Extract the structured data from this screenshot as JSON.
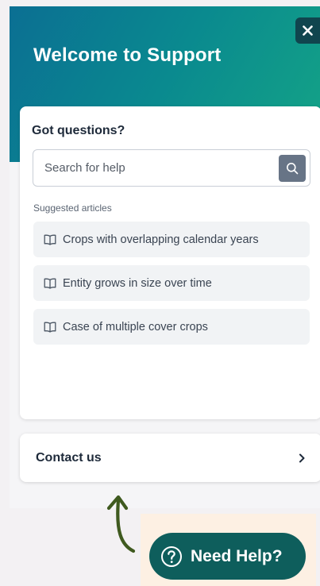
{
  "header": {
    "title": "Welcome to Support"
  },
  "card": {
    "title": "Got questions?",
    "search_placeholder": "Search for help",
    "suggested_label": "Suggested articles",
    "articles": [
      {
        "label": "Crops with overlapping calendar years"
      },
      {
        "label": "Entity grows in size over time"
      },
      {
        "label": "Case of multiple cover crops"
      }
    ]
  },
  "contact": {
    "label": "Contact us",
    "icon": "chevron-right-icon"
  },
  "launcher": {
    "label": "Need Help?",
    "icon": "question-circle-icon"
  },
  "colors": {
    "hero_start": "#0b6f93",
    "hero_end": "#14a486",
    "launcher": "#0e5e5c",
    "search_button": "#677486",
    "arrow": "#3f5a1f"
  }
}
